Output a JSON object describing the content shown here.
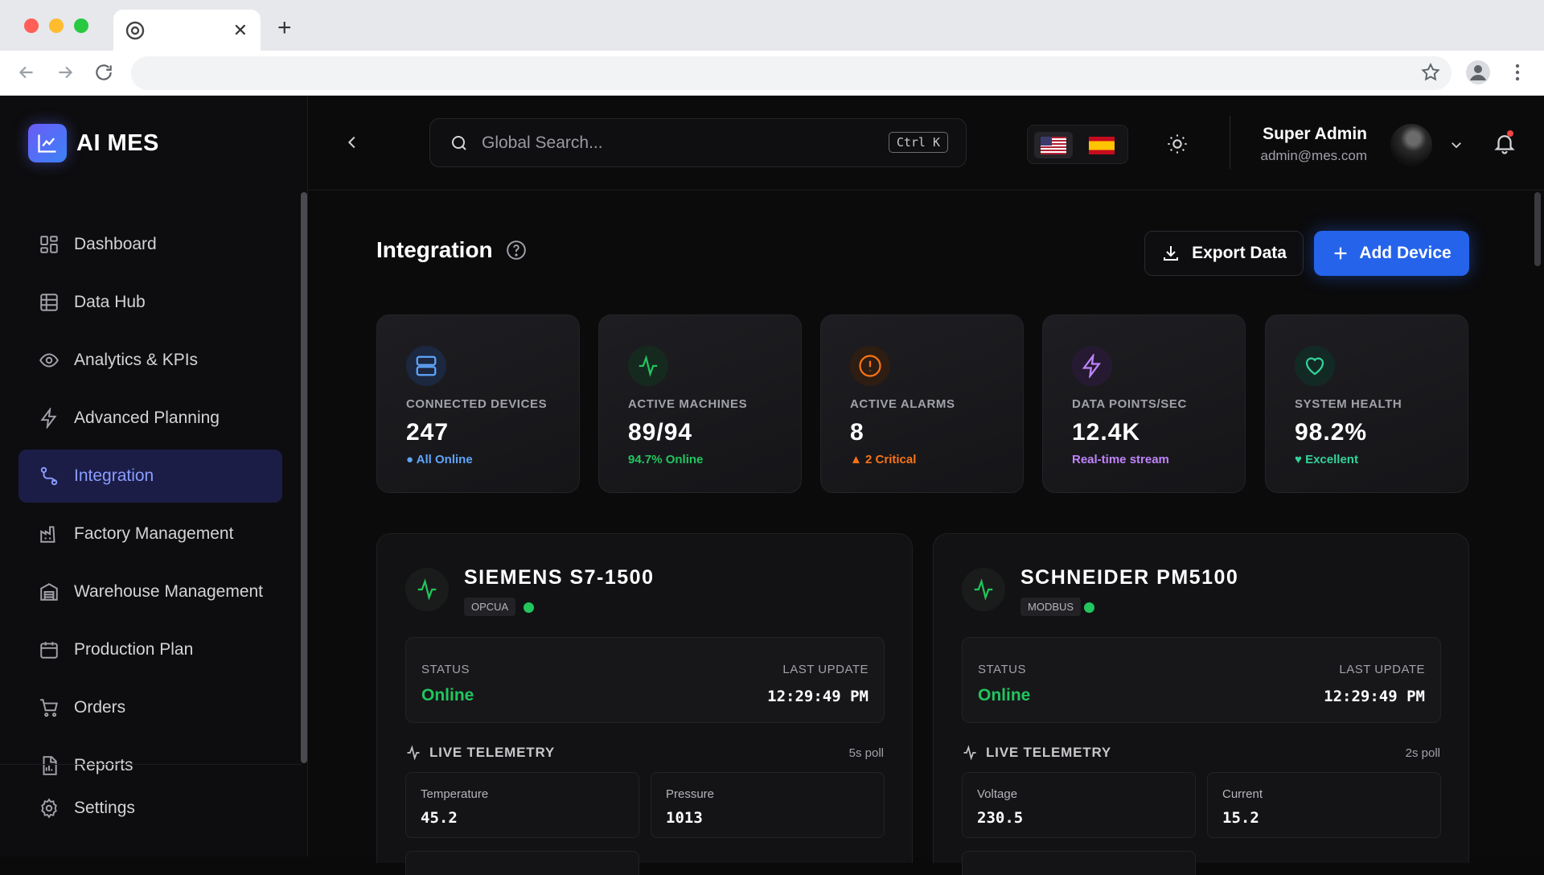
{
  "app": {
    "name": "AI MES"
  },
  "sidebar": {
    "items": [
      {
        "label": "Dashboard",
        "icon": "grid-icon"
      },
      {
        "label": "Data Hub",
        "icon": "table-icon"
      },
      {
        "label": "Analytics & KPIs",
        "icon": "eye-icon"
      },
      {
        "label": "Advanced Planning",
        "icon": "lightning-icon"
      },
      {
        "label": "Integration",
        "icon": "route-icon",
        "active": true
      },
      {
        "label": "Factory Management",
        "icon": "factory-icon"
      },
      {
        "label": "Warehouse Management",
        "icon": "warehouse-icon"
      },
      {
        "label": "Production Plan",
        "icon": "calendar-icon"
      },
      {
        "label": "Orders",
        "icon": "cart-icon"
      },
      {
        "label": "Reports",
        "icon": "report-icon"
      }
    ],
    "settings_label": "Settings"
  },
  "header": {
    "search_placeholder": "Global Search...",
    "search_shortcut": "Ctrl K",
    "languages": [
      "en-US",
      "es"
    ],
    "user": {
      "name": "Super Admin",
      "email": "admin@mes.com"
    }
  },
  "page": {
    "title": "Integration",
    "export_label": "Export Data",
    "add_label": "Add Device"
  },
  "stats": [
    {
      "label": "CONNECTED DEVICES",
      "value": "247",
      "sub": "● All Online",
      "color": "#60a5fa",
      "icon": "server-icon"
    },
    {
      "label": "ACTIVE MACHINES",
      "value": "89/94",
      "sub": "94.7% Online",
      "color": "#22c55e",
      "icon": "activity-icon"
    },
    {
      "label": "ACTIVE ALARMS",
      "value": "8",
      "sub": "▲ 2 Critical",
      "color": "#f97316",
      "icon": "alert-icon"
    },
    {
      "label": "DATA POINTS/SEC",
      "value": "12.4K",
      "sub": "Real-time stream",
      "color": "#c084fc",
      "icon": "bolt-icon"
    },
    {
      "label": "SYSTEM HEALTH",
      "value": "98.2%",
      "sub": "♥ Excellent",
      "color": "#34d399",
      "icon": "heart-icon"
    }
  ],
  "devices": [
    {
      "name": "SIEMENS S7-1500",
      "protocol": "OPCUA",
      "status_label": "STATUS",
      "status": "Online",
      "update_label": "LAST UPDATE",
      "last_update": "12:29:49 PM",
      "telemetry_label": "LIVE TELEMETRY",
      "poll": "5s poll",
      "metrics": [
        {
          "label": "Temperature",
          "value": "45.2"
        },
        {
          "label": "Pressure",
          "value": "1013"
        }
      ]
    },
    {
      "name": "SCHNEIDER PM5100",
      "protocol": "MODBUS",
      "status_label": "STATUS",
      "status": "Online",
      "update_label": "LAST UPDATE",
      "last_update": "12:29:49 PM",
      "telemetry_label": "LIVE TELEMETRY",
      "poll": "2s poll",
      "metrics": [
        {
          "label": "Voltage",
          "value": "230.5"
        },
        {
          "label": "Current",
          "value": "15.2"
        }
      ]
    }
  ],
  "colors": {
    "accent": "#2563eb",
    "online": "#22c55e",
    "sidebar_active_bg": "#1b1d46"
  }
}
